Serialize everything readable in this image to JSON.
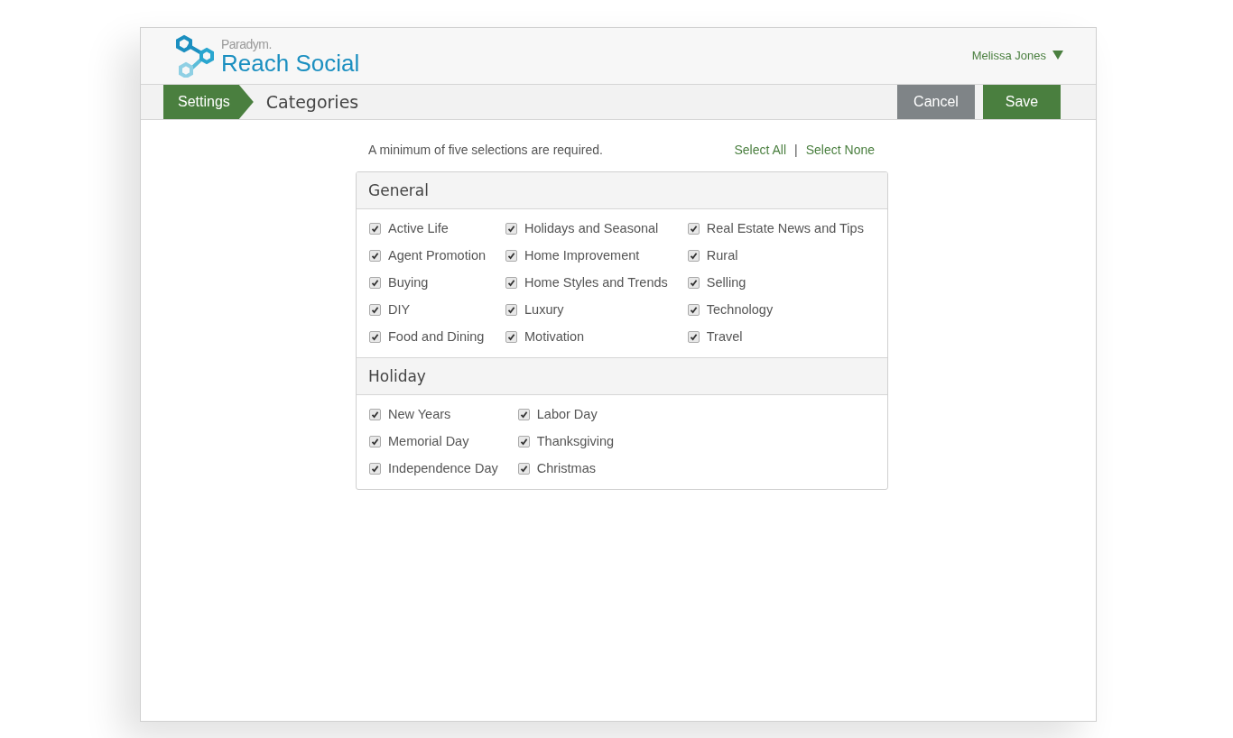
{
  "header": {
    "brand_small": "Paradym.",
    "brand": "Reach Social",
    "user": "Melissa Jones"
  },
  "breadcrumb": {
    "parent": "Settings",
    "current": "Categories"
  },
  "actions": [
    {
      "label": "Cancel",
      "kind": "secondary"
    },
    {
      "label": "Save",
      "kind": "primary"
    }
  ],
  "note": "A minimum of five selections are required.",
  "select_links": [
    "Select All",
    "Select None"
  ],
  "select_separator": "|",
  "groups": [
    {
      "title": "General",
      "columns": [
        [
          {
            "label": "Active Life",
            "checked": true
          },
          {
            "label": "Agent Promotion",
            "checked": true
          },
          {
            "label": "Buying",
            "checked": true
          },
          {
            "label": "DIY",
            "checked": true
          },
          {
            "label": "Food and Dining",
            "checked": true
          }
        ],
        [
          {
            "label": "Holidays and Seasonal",
            "checked": true
          },
          {
            "label": "Home Improvement",
            "checked": true
          },
          {
            "label": "Home Styles and Trends",
            "checked": true
          },
          {
            "label": "Luxury",
            "checked": true
          },
          {
            "label": "Motivation",
            "checked": true
          }
        ],
        [
          {
            "label": "Real Estate News and Tips",
            "checked": true
          },
          {
            "label": "Rural",
            "checked": true
          },
          {
            "label": "Selling",
            "checked": true
          },
          {
            "label": "Technology",
            "checked": true
          },
          {
            "label": "Travel",
            "checked": true
          }
        ]
      ]
    },
    {
      "title": "Holiday",
      "columns": [
        [
          {
            "label": "New Years",
            "checked": true
          },
          {
            "label": "Memorial Day",
            "checked": true
          },
          {
            "label": "Independence Day",
            "checked": true
          }
        ],
        [
          {
            "label": "Labor Day",
            "checked": true
          },
          {
            "label": "Thanksgiving",
            "checked": true
          },
          {
            "label": "Christmas",
            "checked": true
          }
        ]
      ]
    }
  ]
}
